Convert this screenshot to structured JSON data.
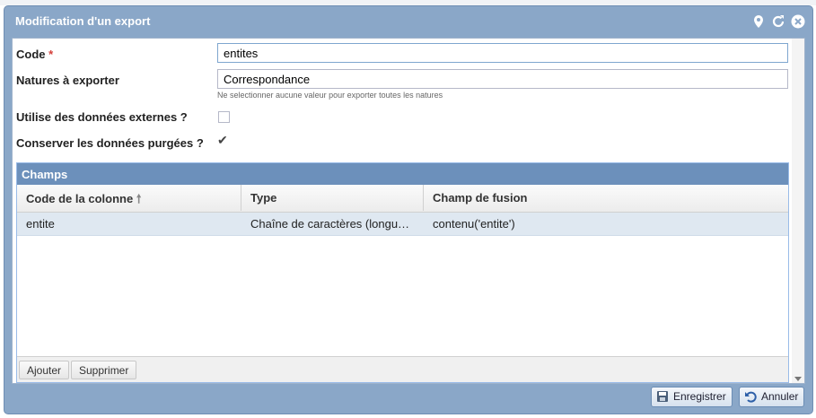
{
  "window": {
    "title": "Modification d'un export"
  },
  "form": {
    "code_label": "Code",
    "required_mark": "*",
    "code_value": "entites",
    "natures_label": "Natures à exporter",
    "natures_value": "Correspondance",
    "natures_hint": "Ne selectionner aucune valeur pour exporter toutes les natures",
    "external_label": "Utilise des données externes ?",
    "external_checked": false,
    "purged_label": "Conserver les données purgées ?",
    "purged_checked": true
  },
  "grid": {
    "title": "Champs",
    "columns": [
      "Code de la colonne",
      "Type",
      "Champ de fusion"
    ],
    "sort_icon": "arrow-up-icon",
    "rows": [
      {
        "code": "entite",
        "type": "Chaîne de caractères (longue…",
        "fusion": "contenu('entite')"
      }
    ],
    "add_label": "Ajouter",
    "delete_label": "Supprimer"
  },
  "buttons": {
    "save": "Enregistrer",
    "cancel": "Annuler"
  },
  "icons": [
    "pin-icon",
    "refresh-icon",
    "close-icon",
    "save-icon",
    "undo-icon",
    "check-icon"
  ],
  "colors": {
    "header": "#8aa7c8",
    "grid_title": "#6c90bb",
    "selected_row": "#dfe8f1",
    "required": "#d43f3a"
  }
}
